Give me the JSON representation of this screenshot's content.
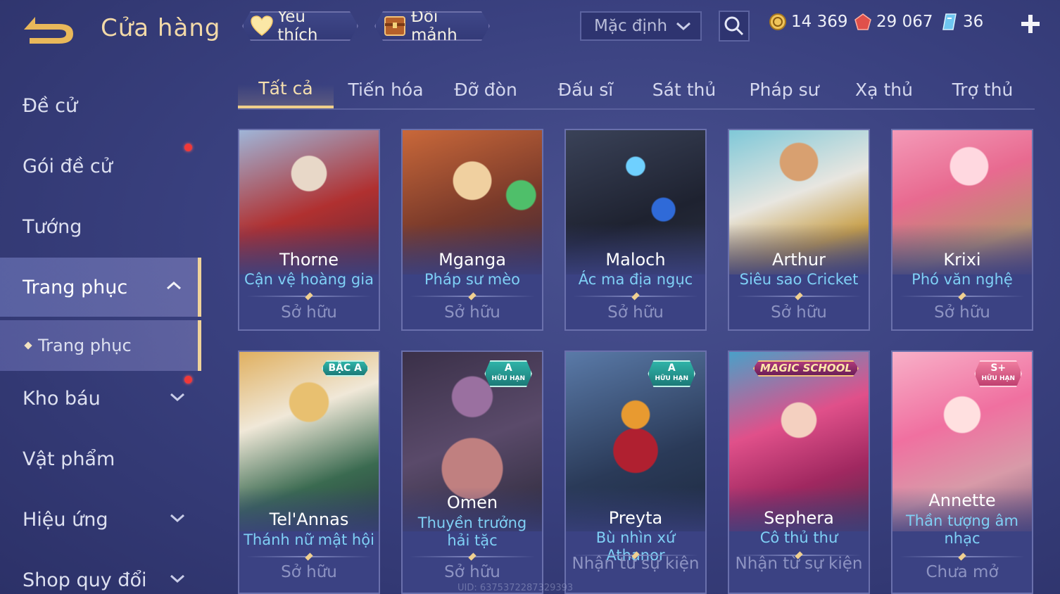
{
  "header": {
    "title": "Cửa hàng",
    "favorite_label": "Yêu thích",
    "shard_label": "Đổi mảnh",
    "sort_value": "Mặc định",
    "currencies": [
      {
        "name": "gold-coin-icon",
        "value": "14 369"
      },
      {
        "name": "voucher-gem-icon",
        "value": "29 067"
      },
      {
        "name": "diamond-icon",
        "value": "36"
      }
    ]
  },
  "sidebar": {
    "items": [
      {
        "label": "Đề cử"
      },
      {
        "label": "Gói đề cử"
      },
      {
        "label": "Tướng"
      },
      {
        "label": "Trang phục"
      },
      {
        "label": "Trang phục"
      },
      {
        "label": "Kho báu"
      },
      {
        "label": "Vật phẩm"
      },
      {
        "label": "Hiệu ứng"
      },
      {
        "label": "Shop quy đổi"
      }
    ]
  },
  "tabs": [
    "Tất cả",
    "Tiến hóa",
    "Đỡ đòn",
    "Đấu sĩ",
    "Sát thủ",
    "Pháp sư",
    "Xạ thủ",
    "Trợ thủ"
  ],
  "cards": [
    {
      "hero": "Thorne",
      "skin": "Cận vệ hoàng gia",
      "status": "Sở hữu"
    },
    {
      "hero": "Mganga",
      "skin": "Pháp sư mèo",
      "status": "Sở hữu"
    },
    {
      "hero": "Maloch",
      "skin": "Ác ma địa ngục",
      "status": "Sở hữu"
    },
    {
      "hero": "Arthur",
      "skin": "Siêu sao Cricket",
      "status": "Sở hữu"
    },
    {
      "hero": "Krixi",
      "skin": "Phó văn nghệ",
      "status": "Sở hữu"
    },
    {
      "hero": "Tel'Annas",
      "skin": "Thánh nữ mật hội",
      "status": "Sở hữu",
      "badge": "BẬC A"
    },
    {
      "hero": "Omen",
      "skin": "Thuyền trưởng hải tặc",
      "status": "Sở hữu",
      "badge": "A",
      "badge_sub": "HỮU HẠN"
    },
    {
      "hero": "Preyta",
      "skin": "Bù nhìn xứ Athanor",
      "status": "Nhận từ sự kiện",
      "badge": "A",
      "badge_sub": "HỮU HẠN"
    },
    {
      "hero": "Sephera",
      "skin": "Cô thủ thư",
      "status": "Nhận từ sự kiện",
      "badge": "MAGIC SCHOOL"
    },
    {
      "hero": "Annette",
      "skin": "Thần tượng âm nhạc",
      "status": "Chưa mở",
      "badge": "S+",
      "badge_sub": "HỮU HẠN"
    }
  ],
  "uid_text": "UID: 6375372287329393"
}
